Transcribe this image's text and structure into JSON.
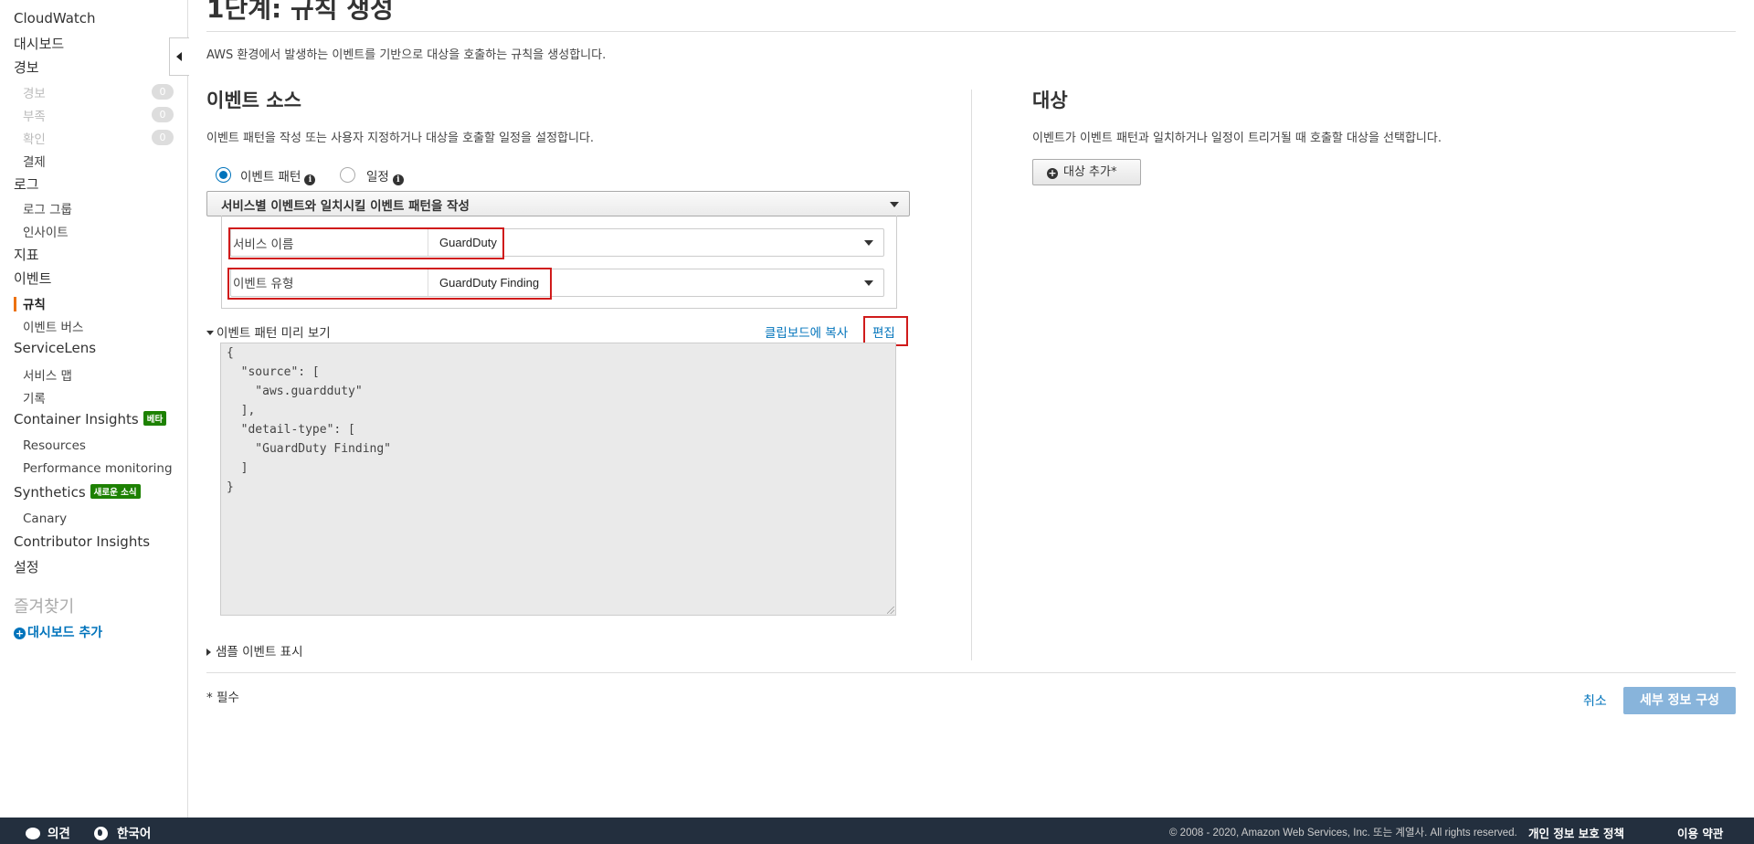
{
  "sidebar": {
    "cloudwatch": "CloudWatch",
    "dashboards": "대시보드",
    "alarms": "경보",
    "alarm_sub": [
      {
        "label": "경보",
        "count": "0"
      },
      {
        "label": "부족",
        "count": "0"
      },
      {
        "label": "확인",
        "count": "0"
      }
    ],
    "billing": "결제",
    "logs": "로그",
    "log_groups": "로그 그룹",
    "insights": "인사이트",
    "metrics": "지표",
    "events": "이벤트",
    "rules": "규칙",
    "event_buses": "이벤트 버스",
    "servicelens": "ServiceLens",
    "service_map": "서비스 맵",
    "traces": "기록",
    "container_insights": "Container Insights",
    "container_badge": "베타",
    "resources": "Resources",
    "performance_monitoring": "Performance monitoring",
    "synthetics": "Synthetics",
    "synthetics_badge": "새로운 소식",
    "canary": "Canary",
    "contributor_insights": "Contributor Insights",
    "settings": "설정",
    "favorites": "즐겨찾기",
    "add_dashboard": "대시보드 추가"
  },
  "main": {
    "title": "1단계: 규칙 생성",
    "description": "AWS 환경에서 발생하는 이벤트를 기반으로 대상을 호출하는 규칙을 생성합니다.",
    "event_source": {
      "title": "이벤트 소스",
      "description": "이벤트 패턴을 작성 또는 사용자 지정하거나 대상을 호출할 일정을 설정합니다.",
      "radio_event_pattern": "이벤트 패턴",
      "radio_schedule": "일정",
      "pattern_select": "서비스별 이벤트와 일치시킬 이벤트 패턴을 작성",
      "service_name_label": "서비스 이름",
      "service_name_value": "GuardDuty",
      "event_type_label": "이벤트 유형",
      "event_type_value": "GuardDuty Finding",
      "preview_label": "이벤트 패턴 미리 보기",
      "copy_clipboard": "클립보드에 복사",
      "edit": "편집",
      "code_lines": [
        "{",
        "  \"source\": [",
        "    \"aws.guardduty\"",
        "  ],",
        "  \"detail-type\": [",
        "    \"GuardDuty Finding\"",
        "  ]",
        "}"
      ],
      "show_sample": "샘플 이벤트 표시"
    },
    "targets": {
      "title": "대상",
      "description": "이벤트가 이벤트 패턴과 일치하거나 일정이 트리거될 때 호출할 대상을 선택합니다.",
      "add_target": "대상 추가*"
    },
    "required_note": "* 필수",
    "cancel": "취소",
    "configure_details": "세부 정보 구성"
  },
  "footer": {
    "feedback": "의견",
    "language": "한국어",
    "copyright": "© 2008 - 2020, Amazon Web Services, Inc. 또는 계열사. All rights reserved.",
    "privacy": "개인 정보 보호 정책",
    "terms": "이용 약관"
  },
  "colors": {
    "link": "#0073bb",
    "highlight_box": "#d01b1b",
    "active_accent": "#ec7211",
    "footer_bg": "#232f3e",
    "primary_disabled": "#88b4db",
    "badge_green": "#1d8102"
  }
}
